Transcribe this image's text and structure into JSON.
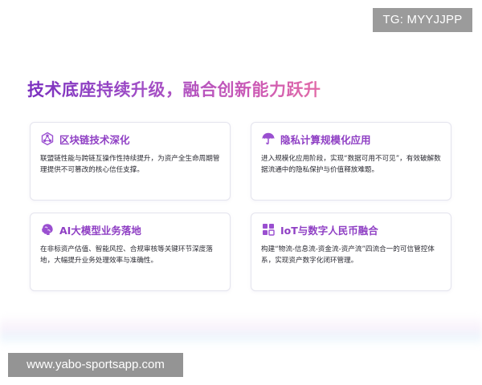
{
  "watermark": {
    "top_right": "TG: MYYJJPP",
    "bottom_left": "www.yabo-sportsapp.com"
  },
  "page": {
    "title": "技术底座持续升级，融合创新能力跃升"
  },
  "colors": {
    "accent_purple": "#8f3fc4",
    "title_gradient_start": "#7a2fbf",
    "title_gradient_end": "#e36ca7"
  },
  "cards": [
    {
      "icon": "blockchain-icon",
      "title": "区块链技术深化",
      "desc": "联盟链性能与跨链互操作性持续提升，为资产全生命周期管理提供不可篡改的核心信任支撑。"
    },
    {
      "icon": "umbrella-icon",
      "title": "隐私计算规模化应用",
      "desc": "进入规模化应用阶段，实现“数据可用不可见”，有效破解数据流通中的隐私保护与价值释放难题。"
    },
    {
      "icon": "brain-icon",
      "title": "AI大模型业务落地",
      "desc": "在非标资产估值、智能风控、合规审核等关键环节深度落地，大幅提升业务处理效率与准确性。"
    },
    {
      "icon": "iot-grid-icon",
      "title": "IoT与数字人民币融合",
      "desc": "构建“物流-信息流-资金流-资产流”四流合一的可信管控体系，实现资产数字化闭环管理。"
    }
  ]
}
